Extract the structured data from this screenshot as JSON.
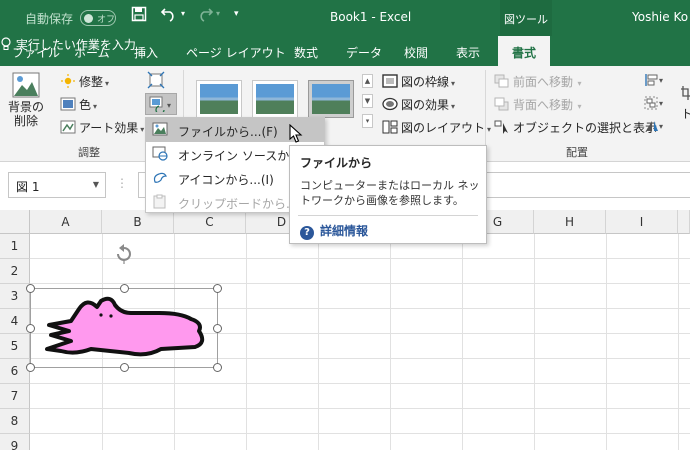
{
  "titlebar": {
    "autosave_label": "自動保存",
    "autosave_state": "オフ",
    "document_title": "Book1  -  Excel",
    "context_tool": "図ツール",
    "user": "Yoshie Ko"
  },
  "tabs": [
    {
      "label": "ファイル"
    },
    {
      "label": "ホーム"
    },
    {
      "label": "挿入"
    },
    {
      "label": "ページ レイアウト"
    },
    {
      "label": "数式"
    },
    {
      "label": "データ"
    },
    {
      "label": "校閲"
    },
    {
      "label": "表示"
    },
    {
      "label": "書式",
      "active": true
    }
  ],
  "tell_me": "実行したい作業を入力",
  "ribbon": {
    "remove_background": [
      "背景の",
      "削除"
    ],
    "corrections": "修整",
    "color": "色",
    "artistic_effects": "アート効果",
    "adjust_group": "調整",
    "picture_border": "図の枠線",
    "picture_effects": "図の効果",
    "picture_layout": "図のレイアウト",
    "bring_forward": "前面へ移動",
    "send_backward": "背面へ移動",
    "selection_pane": "オブジェクトの選択と表示",
    "arrange_group": "配置",
    "crop_partial": "ト"
  },
  "namebox": "図 1",
  "columns": [
    "A",
    "B",
    "C",
    "D",
    "E",
    "F",
    "G",
    "H",
    "I"
  ],
  "rows": [
    "1",
    "2",
    "3",
    "4",
    "5",
    "6",
    "7",
    "8",
    "9"
  ],
  "menu": {
    "items": [
      {
        "label": "ファイルから...(F)",
        "state": "hover"
      },
      {
        "label": "オンライン ソースから...(",
        "state": "normal"
      },
      {
        "label": "アイコンから...(I)",
        "state": "normal"
      },
      {
        "label": "クリップボードから...(C)",
        "state": "disabled"
      }
    ]
  },
  "tooltip": {
    "title": "ファイルから",
    "description": "コンピューターまたはローカル ネットワークから画像を参照します。",
    "help_link": "詳細情報"
  },
  "colors": {
    "excel_green": "#217346",
    "ribbon_bg": "#f3f3f3",
    "menu_hover": "#c5c5c5",
    "shape_fill": "#ff99ee",
    "help_blue": "#2b579a"
  }
}
